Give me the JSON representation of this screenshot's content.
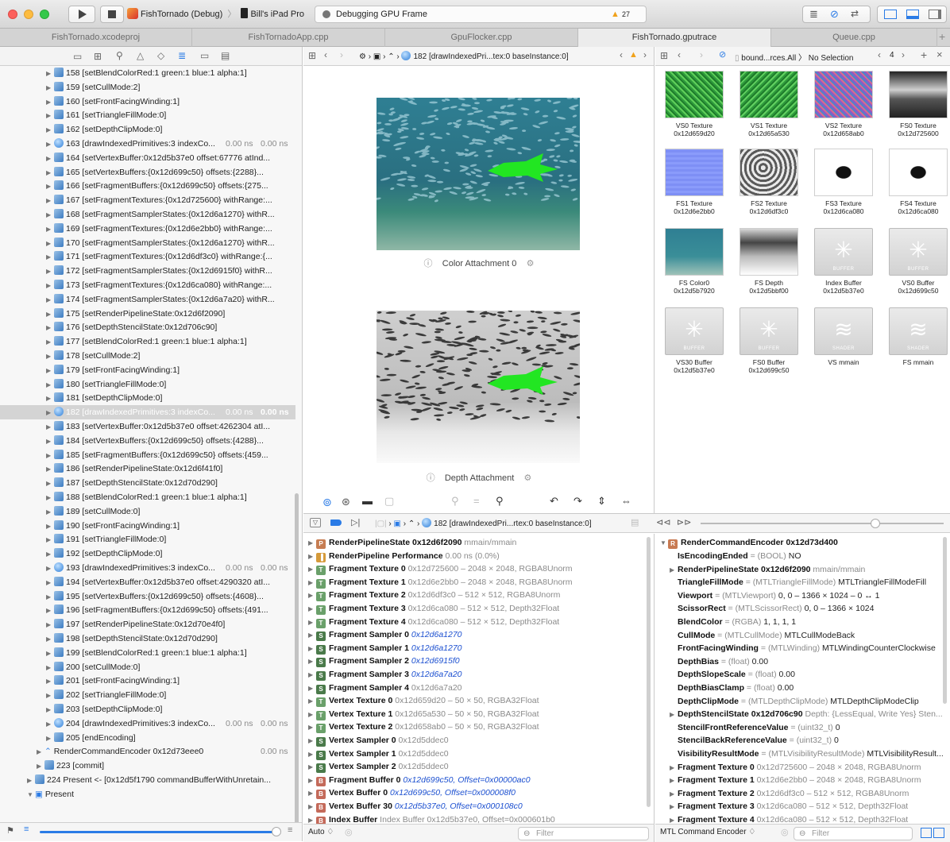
{
  "titlebar": {
    "scheme_app": "FishTornado (Debug)",
    "scheme_device": "Bill's iPad Pro",
    "status": "Debugging GPU Frame",
    "warnings": "27"
  },
  "tabs": [
    {
      "label": "FishTornado.xcodeproj"
    },
    {
      "label": "FishTornadoApp.cpp"
    },
    {
      "label": "GpuFlocker.cpp"
    },
    {
      "label": "FishTornado.gputrace"
    },
    {
      "label": "Queue.cpp"
    }
  ],
  "navigator": {
    "rows": [
      {
        "text": "158 [setBlendColorRed:1 green:1 blue:1 alpha:1]"
      },
      {
        "text": "159 [setCullMode:2]"
      },
      {
        "text": "160 [setFrontFacingWinding:1]"
      },
      {
        "text": "161 [setTriangleFillMode:0]"
      },
      {
        "text": "162 [setDepthClipMode:0]"
      },
      {
        "text": "163 [drawIndexedPrimitives:3 indexCo...",
        "t1": "0.00 ns",
        "t2": "0.00 ns"
      },
      {
        "text": "164 [setVertexBuffer:0x12d5b37e0 offset:67776 atInd..."
      },
      {
        "text": "165 [setVertexBuffers:{0x12d699c50} offsets:{2288}..."
      },
      {
        "text": "166 [setFragmentBuffers:{0x12d699c50} offsets:{275..."
      },
      {
        "text": "167 [setFragmentTextures:{0x12d725600} withRange:..."
      },
      {
        "text": "168 [setFragmentSamplerStates:{0x12d6a1270} withR..."
      },
      {
        "text": "169 [setFragmentTextures:{0x12d6e2bb0} withRange:..."
      },
      {
        "text": "170 [setFragmentSamplerStates:{0x12d6a1270} withR..."
      },
      {
        "text": "171 [setFragmentTextures:{0x12d6df3c0} withRange:{..."
      },
      {
        "text": "172 [setFragmentSamplerStates:{0x12d6915f0} withR..."
      },
      {
        "text": "173 [setFragmentTextures:{0x12d6ca080} withRange:..."
      },
      {
        "text": "174 [setFragmentSamplerStates:{0x12d6a7a20} withR..."
      },
      {
        "text": "175 [setRenderPipelineState:0x12d6f2090]"
      },
      {
        "text": "176 [setDepthStencilState:0x12d706c90]"
      },
      {
        "text": "177 [setBlendColorRed:1 green:1 blue:1 alpha:1]"
      },
      {
        "text": "178 [setCullMode:2]"
      },
      {
        "text": "179 [setFrontFacingWinding:1]"
      },
      {
        "text": "180 [setTriangleFillMode:0]"
      },
      {
        "text": "181 [setDepthClipMode:0]"
      },
      {
        "text": "182 [drawIndexedPrimitives:3 indexCo...",
        "t1": "0.00 ns",
        "t2": "0.00 ns"
      },
      {
        "text": "183 [setVertexBuffer:0x12d5b37e0 offset:4262304 atI..."
      },
      {
        "text": "184 [setVertexBuffers:{0x12d699c50} offsets:{4288}..."
      },
      {
        "text": "185 [setFragmentBuffers:{0x12d699c50} offsets:{459..."
      },
      {
        "text": "186 [setRenderPipelineState:0x12d6f41f0]"
      },
      {
        "text": "187 [setDepthStencilState:0x12d70d290]"
      },
      {
        "text": "188 [setBlendColorRed:1 green:1 blue:1 alpha:1]"
      },
      {
        "text": "189 [setCullMode:0]"
      },
      {
        "text": "190 [setFrontFacingWinding:1]"
      },
      {
        "text": "191 [setTriangleFillMode:0]"
      },
      {
        "text": "192 [setDepthClipMode:0]"
      },
      {
        "text": "193 [drawIndexedPrimitives:3 indexCo...",
        "t1": "0.00 ns",
        "t2": "0.00 ns"
      },
      {
        "text": "194 [setVertexBuffer:0x12d5b37e0 offset:4290320 atI..."
      },
      {
        "text": "195 [setVertexBuffers:{0x12d699c50} offsets:{4608}..."
      },
      {
        "text": "196 [setFragmentBuffers:{0x12d699c50} offsets:{491..."
      },
      {
        "text": "197 [setRenderPipelineState:0x12d70e4f0]"
      },
      {
        "text": "198 [setDepthStencilState:0x12d70d290]"
      },
      {
        "text": "199 [setBlendColorRed:1 green:1 blue:1 alpha:1]"
      },
      {
        "text": "200 [setCullMode:0]"
      },
      {
        "text": "201 [setFrontFacingWinding:1]"
      },
      {
        "text": "202 [setTriangleFillMode:0]"
      },
      {
        "text": "203 [setDepthClipMode:0]"
      },
      {
        "text": "204 [drawIndexedPrimitives:3 indexCo...",
        "t1": "0.00 ns",
        "t2": "0.00 ns"
      },
      {
        "text": "205 [endEncoding]"
      }
    ],
    "encoder": {
      "text": "RenderCommandEncoder 0x12d73eee0",
      "t": "0.00 ns"
    },
    "commit": "223 [commit]",
    "present_long": "224 Present <- [0x12d5f1790 commandBufferWithUnretain...",
    "present": "Present"
  },
  "center": {
    "breadcrumb": "182 [drawIndexedPri...tex:0 baseInstance:0]",
    "color_attachment": "Color Attachment 0",
    "depth_attachment": "Depth Attachment"
  },
  "assistant": {
    "breadcrumb_res": "bound...rces.All",
    "no_selection": "No Selection",
    "page": "4",
    "thumbs": [
      {
        "name": "VS0 Texture",
        "addr": "0x12d659d20"
      },
      {
        "name": "VS1 Texture",
        "addr": "0x12d65a530"
      },
      {
        "name": "VS2 Texture",
        "addr": "0x12d658ab0"
      },
      {
        "name": "FS0 Texture",
        "addr": "0x12d725600"
      },
      {
        "name": "FS1 Texture",
        "addr": "0x12d6e2bb0"
      },
      {
        "name": "FS2 Texture",
        "addr": "0x12d6df3c0"
      },
      {
        "name": "FS3 Texture",
        "addr": "0x12d6ca080"
      },
      {
        "name": "FS4 Texture",
        "addr": "0x12d6ca080"
      },
      {
        "name": "FS Color0",
        "addr": "0x12d5b7920"
      },
      {
        "name": "FS Depth",
        "addr": "0x12d5bbf00"
      },
      {
        "name": "Index Buffer",
        "addr": "0x12d5b37e0",
        "stub": "BUFFER"
      },
      {
        "name": "VS0 Buffer",
        "addr": "0x12d699c50",
        "stub": "BUFFER"
      },
      {
        "name": "VS30 Buffer",
        "addr": "0x12d5b37e0",
        "stub": "BUFFER"
      },
      {
        "name": "FS0 Buffer",
        "addr": "0x12d699c50",
        "stub": "BUFFER"
      },
      {
        "name": "VS mmain",
        "addr": "",
        "stub": "SHADER"
      },
      {
        "name": "FS mmain",
        "addr": "",
        "stub": "SHADER"
      }
    ]
  },
  "debugbar": {
    "breadcrumb": "182 [drawIndexedPri...rtex:0 baseInstance:0]"
  },
  "state_list": [
    {
      "badge": "P",
      "cls": "b-P",
      "label": "RenderPipelineState 0x12d6f2090",
      "gray": " mmain/mmain"
    },
    {
      "badge": "▐",
      "cls": "b-perf",
      "label": "RenderPipeline Performance",
      "gray": " 0.00 ns (0.0%)"
    },
    {
      "badge": "T",
      "cls": "b-T",
      "label": "Fragment Texture 0",
      "gray": " 0x12d725600 – 2048 × 2048, RGBA8Unorm"
    },
    {
      "badge": "T",
      "cls": "b-T",
      "label": "Fragment Texture 1",
      "gray": " 0x12d6e2bb0 – 2048 × 2048, RGBA8Unorm"
    },
    {
      "badge": "T",
      "cls": "b-T",
      "label": "Fragment Texture 2",
      "gray": " 0x12d6df3c0 – 512 × 512, RGBA8Unorm"
    },
    {
      "badge": "T",
      "cls": "b-T",
      "label": "Fragment Texture 3",
      "gray": " 0x12d6ca080 – 512 × 512, Depth32Float"
    },
    {
      "badge": "T",
      "cls": "b-T",
      "label": "Fragment Texture 4",
      "gray": " 0x12d6ca080 – 512 × 512, Depth32Float"
    },
    {
      "badge": "S",
      "cls": "b-S",
      "label": "Fragment Sampler 0",
      "italic": " 0x12d6a1270"
    },
    {
      "badge": "S",
      "cls": "b-S",
      "label": "Fragment Sampler 1",
      "italic": " 0x12d6a1270"
    },
    {
      "badge": "S",
      "cls": "b-S",
      "label": "Fragment Sampler 2",
      "italic": " 0x12d6915f0"
    },
    {
      "badge": "S",
      "cls": "b-S",
      "label": "Fragment Sampler 3",
      "italic": " 0x12d6a7a20"
    },
    {
      "badge": "S",
      "cls": "b-S",
      "label": "Fragment Sampler 4",
      "gray": " 0x12d6a7a20"
    },
    {
      "badge": "T",
      "cls": "b-T",
      "label": "Vertex Texture 0",
      "gray": " 0x12d659d20 – 50 × 50, RGBA32Float"
    },
    {
      "badge": "T",
      "cls": "b-T",
      "label": "Vertex Texture 1",
      "gray": " 0x12d65a530 – 50 × 50, RGBA32Float"
    },
    {
      "badge": "T",
      "cls": "b-T",
      "label": "Vertex Texture 2",
      "gray": " 0x12d658ab0 – 50 × 50, RGBA32Float"
    },
    {
      "badge": "S",
      "cls": "b-S",
      "label": "Vertex Sampler 0",
      "gray": " 0x12d5ddec0"
    },
    {
      "badge": "S",
      "cls": "b-S",
      "label": "Vertex Sampler 1",
      "gray": " 0x12d5ddec0"
    },
    {
      "badge": "S",
      "cls": "b-S",
      "label": "Vertex Sampler 2",
      "gray": " 0x12d5ddec0"
    },
    {
      "badge": "B",
      "cls": "b-B",
      "label": "Fragment Buffer 0",
      "italic": " 0x12d699c50, Offset=0x00000ac0"
    },
    {
      "badge": "B",
      "cls": "b-B",
      "label": "Vertex Buffer 0",
      "italic": " 0x12d699c50, Offset=0x000008f0"
    },
    {
      "badge": "B",
      "cls": "b-B",
      "label": "Vertex Buffer 30",
      "italic": " 0x12d5b37e0, Offset=0x000108c0"
    },
    {
      "badge": "B",
      "cls": "b-B",
      "label": "Index Buffer",
      "gray": " Index Buffer 0x12d5b37e0, Offset=0x000601b0"
    }
  ],
  "encoder_detail": {
    "header": "RenderCommandEncoder 0x12d73d400",
    "rows": [
      {
        "indent": 1,
        "key": "IsEncodingEnded",
        "type": " = (BOOL) ",
        "val": "NO"
      },
      {
        "indent": 0,
        "tri": true,
        "key": "RenderPipelineState 0x12d6f2090",
        "type": " mmain/mmain",
        "val": ""
      },
      {
        "indent": 1,
        "key": "TriangleFillMode",
        "type": " = (MTLTriangleFillMode) ",
        "val": "MTLTriangleFillModeFill"
      },
      {
        "indent": 1,
        "key": "Viewport",
        "type": " = (MTLViewport) ",
        "val": "0, 0 – 1366 × 1024 – 0 ↔ 1"
      },
      {
        "indent": 1,
        "key": "ScissorRect",
        "type": " = (MTLScissorRect) ",
        "val": "0, 0 – 1366 × 1024"
      },
      {
        "indent": 1,
        "key": "BlendColor",
        "type": " = (RGBA) ",
        "val": "1, 1, 1, 1"
      },
      {
        "indent": 1,
        "key": "CullMode",
        "type": " = (MTLCullMode) ",
        "val": "MTLCullModeBack"
      },
      {
        "indent": 1,
        "key": "FrontFacingWinding",
        "type": " = (MTLWinding) ",
        "val": "MTLWindingCounterClockwise"
      },
      {
        "indent": 1,
        "key": "DepthBias",
        "type": " = (float) ",
        "val": "0.00"
      },
      {
        "indent": 1,
        "key": "DepthSlopeScale",
        "type": " = (float) ",
        "val": "0.00"
      },
      {
        "indent": 1,
        "key": "DepthBiasClamp",
        "type": " = (float) ",
        "val": "0.00"
      },
      {
        "indent": 1,
        "key": "DepthClipMode",
        "type": " = (MTLDepthClipMode) ",
        "val": "MTLDepthClipModeClip"
      },
      {
        "indent": 0,
        "tri": true,
        "key": "DepthStencilState 0x12d706c90",
        "type": " Depth: {LessEqual, Write Yes} Sten...",
        "val": ""
      },
      {
        "indent": 1,
        "key": "StencilFrontReferenceValue",
        "type": " = (uint32_t) ",
        "val": "0"
      },
      {
        "indent": 1,
        "key": "StencilBackReferenceValue",
        "type": " = (uint32_t) ",
        "val": "0"
      },
      {
        "indent": 1,
        "key": "VisibilityResultMode",
        "type": " = (MTLVisibilityResultMode) ",
        "val": "MTLVisibilityResult..."
      },
      {
        "indent": 0,
        "tri": true,
        "key": "Fragment Texture 0",
        "type": " 0x12d725600 – 2048 × 2048, RGBA8Unorm",
        "val": ""
      },
      {
        "indent": 0,
        "tri": true,
        "key": "Fragment Texture 1",
        "type": " 0x12d6e2bb0 – 2048 × 2048, RGBA8Unorm",
        "val": ""
      },
      {
        "indent": 0,
        "tri": true,
        "key": "Fragment Texture 2",
        "type": " 0x12d6df3c0 – 512 × 512, RGBA8Unorm",
        "val": ""
      },
      {
        "indent": 0,
        "tri": true,
        "key": "Fragment Texture 3",
        "type": " 0x12d6ca080 – 512 × 512, Depth32Float",
        "val": ""
      },
      {
        "indent": 0,
        "tri": true,
        "key": "Fragment Texture 4",
        "type": " 0x12d6ca080 – 512 × 512, Depth32Float",
        "val": ""
      }
    ]
  },
  "bottom": {
    "auto": "Auto ♢",
    "filter": "Filter",
    "encoder_menu": "MTL Command Encoder ♢"
  }
}
